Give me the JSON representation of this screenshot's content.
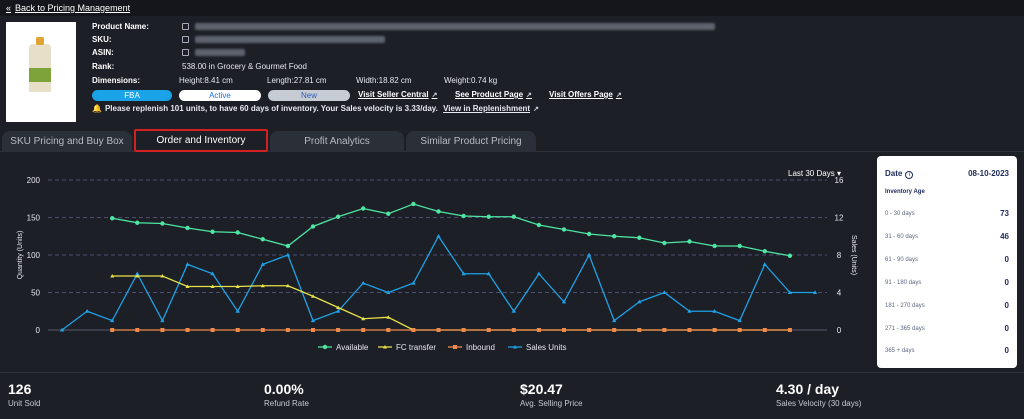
{
  "nav": {
    "back_label": "Back to Pricing Management"
  },
  "product": {
    "labels": {
      "name": "Product Name:",
      "sku": "SKU:",
      "asin": "ASIN:",
      "rank": "Rank:",
      "dimensions": "Dimensions:"
    },
    "rank": "538.00 in Grocery & Gourmet Food",
    "height": "Height:8.41 cm",
    "length": "Length:27.81 cm",
    "width": "Width:18.82 cm",
    "weight": "Weight:0.74 kg",
    "badges": {
      "fulfillment": "FBA",
      "status": "Active",
      "condition": "New"
    },
    "links": {
      "seller_central": "Visit Seller Central",
      "product_page": "See Product Page",
      "offers_page": "Visit Offers Page"
    },
    "alert": "Please replenish 101 units, to have 60 days of inventory. Your Sales velocity is 3.33/day.",
    "alert_link": "View in Replenishment"
  },
  "tabs": [
    {
      "label": "SKU Pricing and Buy Box"
    },
    {
      "label": "Order and Inventory"
    },
    {
      "label": "Profit Analytics"
    },
    {
      "label": "Similar Product Pricing"
    }
  ],
  "range_label": "Last 30 Days",
  "colors": {
    "available": "#4ee6a3",
    "fc_transfer": "#e8e24a",
    "inbound": "#f08a4b",
    "sales": "#1ea1e6",
    "bg": "#1c1f26"
  },
  "chart_data": {
    "type": "line",
    "ylabel": "Quantity (Units)",
    "y2label": "Sales (Units)",
    "ylim": [
      0,
      200
    ],
    "y2lim": [
      0,
      16
    ],
    "yticks": [
      0,
      50,
      100,
      150,
      200
    ],
    "y2ticks": [
      0,
      4,
      8,
      12,
      16
    ],
    "legend": "bottom",
    "series": [
      {
        "name": "Available",
        "axis": "left",
        "start": 2,
        "values": [
          149,
          143,
          142,
          136,
          131,
          130,
          121,
          112,
          138,
          151,
          162,
          155,
          168,
          158,
          152,
          151,
          151,
          140,
          134,
          128,
          125,
          123,
          116,
          118,
          112,
          112,
          105,
          99
        ]
      },
      {
        "name": "FC transfer",
        "axis": "left",
        "start": 2,
        "values": [
          72,
          72,
          72,
          58,
          58,
          58,
          59,
          59,
          45,
          30,
          15,
          17,
          0,
          0,
          0,
          0,
          0,
          0,
          0,
          0,
          0,
          0,
          0,
          0,
          0,
          0,
          0,
          0
        ]
      },
      {
        "name": "Inbound",
        "axis": "left",
        "start": 2,
        "values": [
          0,
          0,
          0,
          0,
          0,
          0,
          0,
          0,
          0,
          0,
          0,
          0,
          0,
          0,
          0,
          0,
          0,
          0,
          0,
          0,
          0,
          0,
          0,
          0,
          0,
          0,
          0,
          0
        ]
      },
      {
        "name": "Sales Units",
        "axis": "right",
        "start": 0,
        "values": [
          0,
          2,
          1,
          6,
          1,
          7,
          6,
          2,
          7,
          8,
          1,
          2,
          5,
          4,
          5,
          10,
          6,
          6,
          2,
          6,
          3,
          8,
          1,
          3,
          4,
          2,
          2,
          1,
          7,
          4,
          4
        ]
      }
    ]
  },
  "inventory_panel": {
    "date_label": "Date",
    "date_value": "08-10-2023",
    "age_heading": "Inventory Age",
    "rows": [
      {
        "label": "0 - 30 days",
        "value": "73"
      },
      {
        "label": "31 - 60 days",
        "value": "46"
      },
      {
        "label": "61 - 90 days",
        "value": "0"
      },
      {
        "label": "91 - 180 days",
        "value": "0"
      },
      {
        "label": "181 - 270 days",
        "value": "0"
      },
      {
        "label": "271 - 365 days",
        "value": "0"
      },
      {
        "label": "365 + days",
        "value": "0"
      }
    ]
  },
  "stats": [
    {
      "value": "126",
      "label": "Unit Sold"
    },
    {
      "value": "0.00%",
      "label": "Refund Rate"
    },
    {
      "value": "$20.47",
      "label": "Avg. Selling Price"
    },
    {
      "value": "4.30 / day",
      "label": "Sales Velocity (30 days)"
    }
  ]
}
